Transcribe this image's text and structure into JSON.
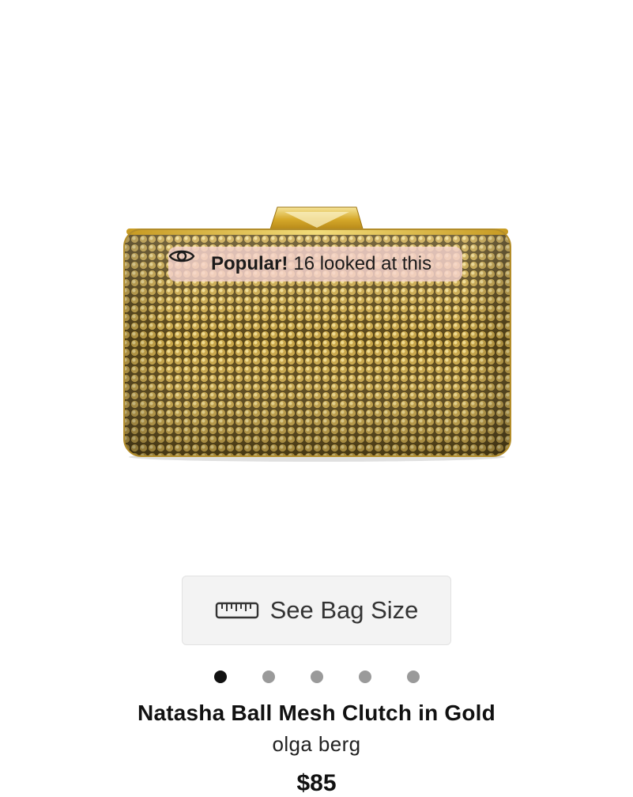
{
  "product": {
    "image_name": "gold-mesh-clutch-image",
    "title": "Natasha Ball Mesh Clutch in Gold",
    "brand": "olga berg",
    "price": "$85"
  },
  "badge": {
    "strong": "Popular!",
    "text": "16 looked at this",
    "icon": "eye-icon"
  },
  "bag_size_button": {
    "label": "See Bag Size",
    "icon": "ruler-icon"
  },
  "carousel": {
    "total": 5,
    "active_index": 0
  },
  "colors": {
    "badge_bg": "#f6d4d0",
    "button_bg": "#f3f3f3",
    "dot_active": "#111111",
    "dot_inactive": "#9a9a9a",
    "gold": "#d8b03f"
  }
}
